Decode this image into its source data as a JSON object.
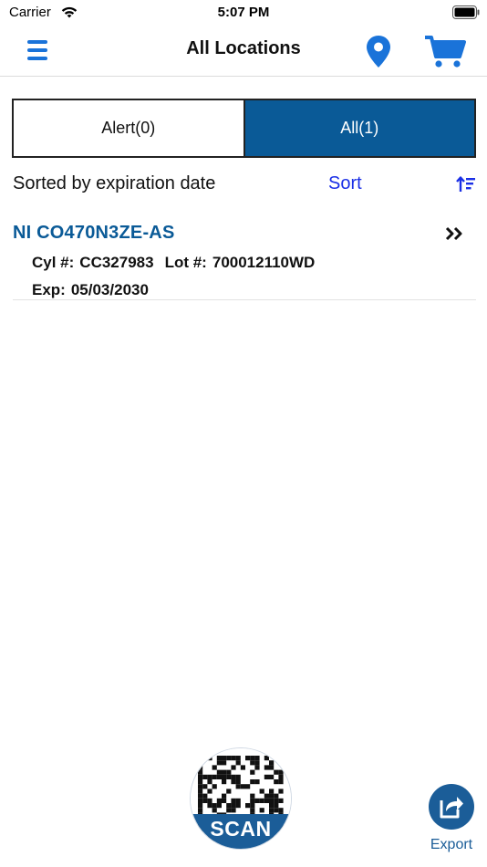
{
  "status_bar": {
    "carrier": "Carrier",
    "time": "5:07 PM"
  },
  "nav": {
    "title": "All Locations",
    "icons": [
      "menu-icon",
      "location-pin-icon",
      "cart-icon"
    ]
  },
  "segments": {
    "alert_label": "Alert(0)",
    "all_label": "All(1)",
    "selected": "all"
  },
  "sort": {
    "label": "Sorted by expiration date",
    "button_label": "Sort",
    "icon": "sort-ascending-icon"
  },
  "items": [
    {
      "title": "NI CO470N3ZE-AS",
      "cyl_label": "Cyl #:",
      "cyl_value": "CC327983",
      "lot_label": "Lot #:",
      "lot_value": "700012110WD",
      "exp_label": "Exp:",
      "exp_value": "05/03/2030"
    }
  ],
  "scan": {
    "label": "SCAN"
  },
  "export": {
    "label": "Export"
  },
  "colors": {
    "accent_blue": "#1a73d9",
    "brand_blue": "#0a5a97",
    "sort_blue": "#1a2fe6"
  }
}
